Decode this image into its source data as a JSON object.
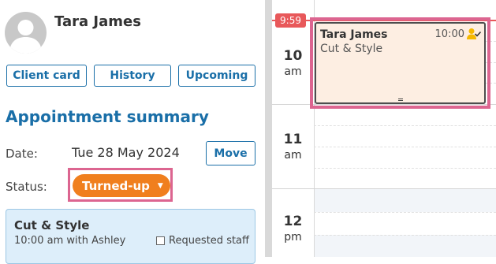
{
  "client": {
    "name": "Tara James"
  },
  "buttons": {
    "client_card": "Client card",
    "history": "History",
    "upcoming": "Upcoming",
    "move": "Move"
  },
  "summary": {
    "title": "Appointment summary",
    "date_label": "Date:",
    "date_value": "Tue 28 May 2024",
    "status_label": "Status:",
    "status_value": "Turned-up"
  },
  "service": {
    "name": "Cut & Style",
    "detail": "10:00 am with Ashley",
    "requested_label": "Requested staff",
    "requested_checked": false
  },
  "calendar": {
    "current_time": "9:59",
    "hours": [
      {
        "num": "10",
        "ampm": "am"
      },
      {
        "num": "11",
        "ampm": "am"
      },
      {
        "num": "12",
        "ampm": "pm"
      }
    ],
    "appointment": {
      "client": "Tara James",
      "service": "Cut & Style",
      "time": "10:00",
      "status_icon": "client-turned-up-icon"
    }
  },
  "colors": {
    "accent": "#1a6fa8",
    "status": "#f07f1e",
    "highlight": "#dc6590",
    "now_line": "#e8585a",
    "appointment_bg": "#fdeee2"
  }
}
